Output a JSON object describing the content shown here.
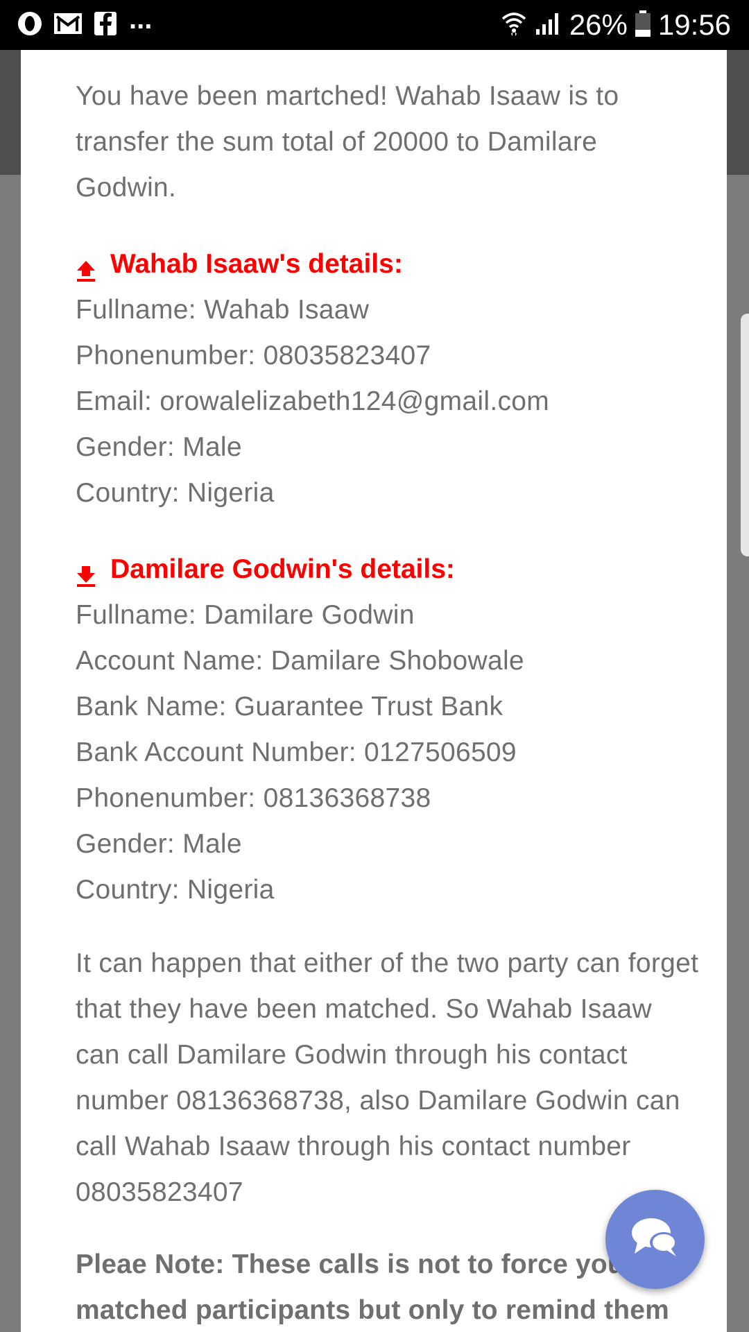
{
  "status_bar": {
    "icons_left": [
      "opera-icon",
      "gmail-icon",
      "facebook-icon"
    ],
    "more": "...",
    "battery": "26%",
    "time": "19:56"
  },
  "intro": "You have been martched! Wahab Isaaw is to transfer the sum total of 20000 to Damilare Godwin.",
  "payer": {
    "title": "Wahab Isaaw's details:",
    "icon": "upload-icon",
    "lines": [
      "Fullname: Wahab Isaaw",
      "Phonenumber: 08035823407",
      "Email: orowalelizabeth124@gmail.com",
      "Gender: Male",
      "Country: Nigeria"
    ]
  },
  "receiver": {
    "title": "Damilare Godwin's details:",
    "icon": "download-icon",
    "lines": [
      "Fullname: Damilare Godwin",
      "Account Name: Damilare Shobowale",
      "Bank Name: Guarantee Trust Bank",
      "Bank Account Number: 0127506509",
      "Phonenumber: 08136368738",
      "Gender: Male",
      "Country: Nigeria"
    ]
  },
  "reminder": "It can happen that either of the two party can forget that they have been matched. So Wahab Isaaw can call Damilare Godwin through his contact number 08136368738, also Damilare Godwin can call Wahab Isaaw through his contact number 08035823407",
  "note": "Pleae Note: These calls is not to force your matched participants but only to remind them",
  "colors": {
    "section_title": "#ff0000",
    "body_text": "#6f6f6f",
    "chat_fab": "#6f86d6"
  },
  "chat_button": {
    "icon": "chat-bubbles-icon"
  }
}
